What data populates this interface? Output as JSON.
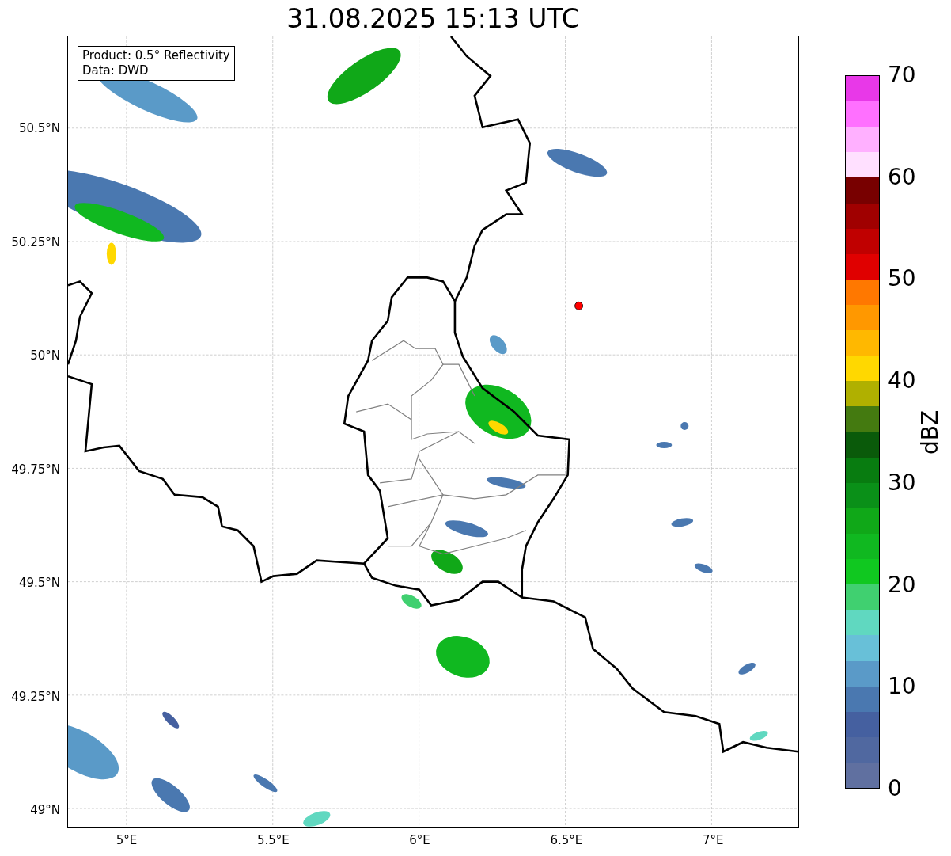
{
  "title": "31.08.2025 15:13 UTC",
  "info_box": [
    "Product: 0.5° Reflectivity",
    "Data: DWD"
  ],
  "map": {
    "lat_ticks": [
      "50.5°N",
      "50.25°N",
      "50°N",
      "49.75°N",
      "49.5°N",
      "49.25°N",
      "49°N"
    ],
    "lon_ticks": [
      "5°E",
      "5.5°E",
      "6°E",
      "6.5°E",
      "7°E"
    ]
  },
  "colorbar": {
    "label": "dBZ",
    "ticks": [
      "70",
      "60",
      "50",
      "40",
      "30",
      "20",
      "10",
      "0"
    ],
    "segments": [
      {
        "color": "#e838e8"
      },
      {
        "color": "#ff70ff"
      },
      {
        "color": "#ffb0ff"
      },
      {
        "color": "#ffe0ff"
      },
      {
        "color": "#780000"
      },
      {
        "color": "#a00000"
      },
      {
        "color": "#c00000"
      },
      {
        "color": "#e00000"
      },
      {
        "color": "#ff7800"
      },
      {
        "color": "#ff9800"
      },
      {
        "color": "#ffb800"
      },
      {
        "color": "#ffd800"
      },
      {
        "color": "#b0b000"
      },
      {
        "color": "#447a10"
      },
      {
        "color": "#0a5a0a"
      },
      {
        "color": "#087c10"
      },
      {
        "color": "#0a9018"
      },
      {
        "color": "#10a818"
      },
      {
        "color": "#10b820"
      },
      {
        "color": "#10c820"
      },
      {
        "color": "#40d070"
      },
      {
        "color": "#60d8c0"
      },
      {
        "color": "#68c0d8"
      },
      {
        "color": "#5a9ac8"
      },
      {
        "color": "#4a78b0"
      },
      {
        "color": "#4560a0"
      },
      {
        "color": "#5068a0"
      },
      {
        "color": "#6070a0"
      }
    ]
  }
}
